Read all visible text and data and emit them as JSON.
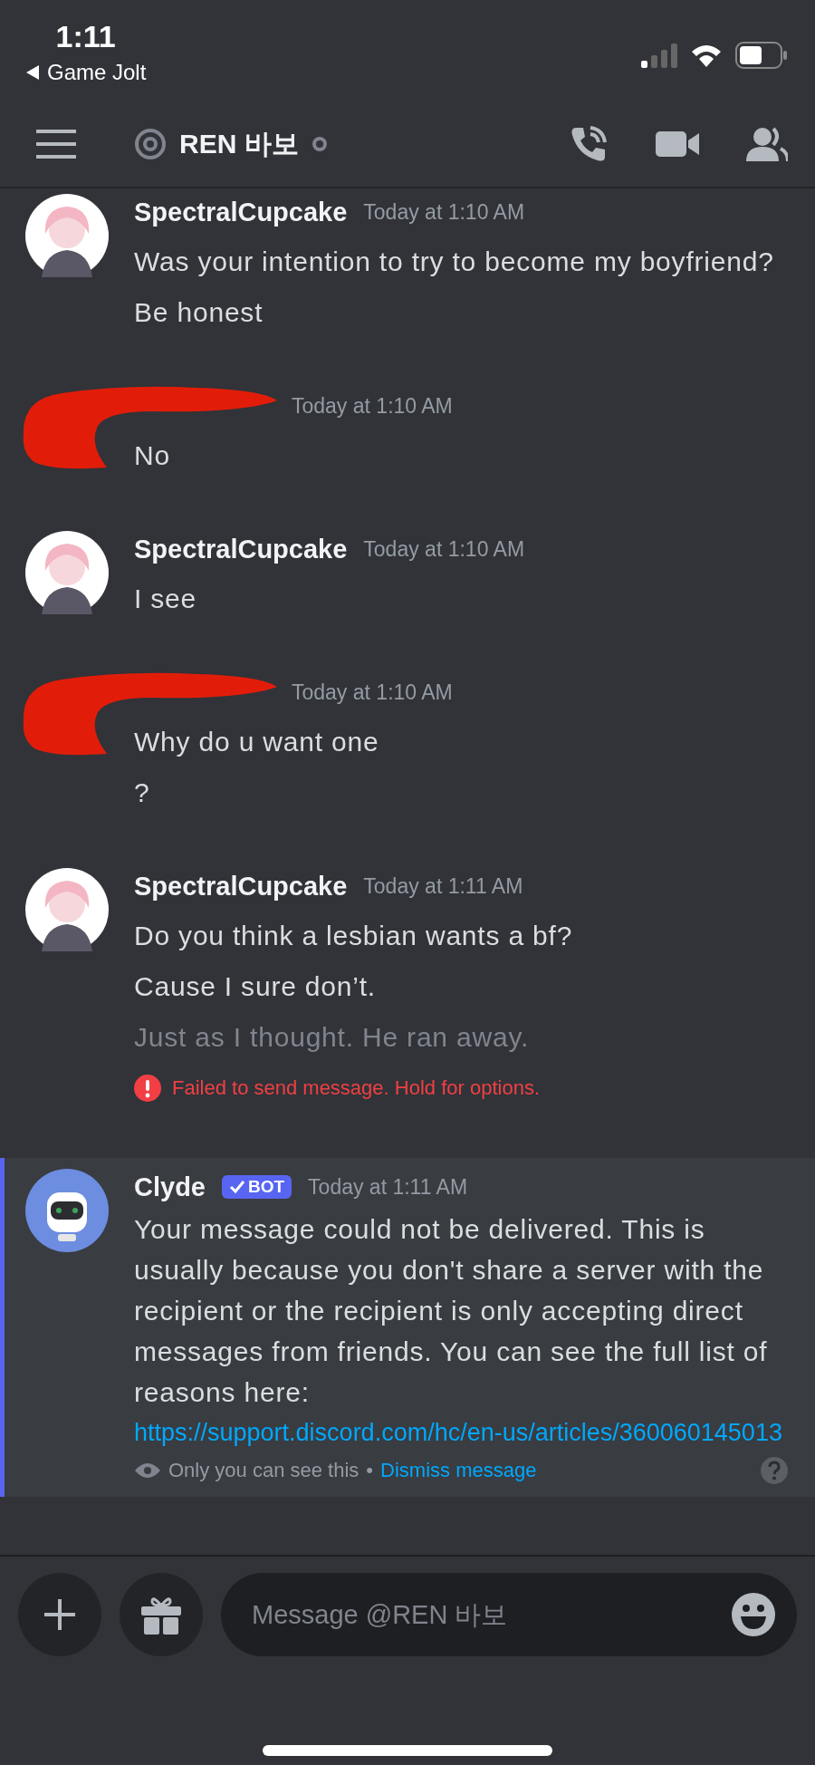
{
  "status_bar": {
    "time": "1:11",
    "back_label": "Game Jolt"
  },
  "header": {
    "channel_name": "REN 바보"
  },
  "messages": [
    {
      "author": "SpectralCupcake",
      "redacted": false,
      "time": "Today at 1:10 AM",
      "lines": [
        {
          "text": "Was your intention to try to become my boyfriend?",
          "failed": false
        },
        {
          "text": "Be honest",
          "failed": false
        }
      ]
    },
    {
      "redacted": true,
      "time": "Today at 1:10 AM",
      "lines": [
        {
          "text": "No",
          "failed": false
        }
      ]
    },
    {
      "author": "SpectralCupcake",
      "redacted": false,
      "time": "Today at 1:10 AM",
      "lines": [
        {
          "text": "I see",
          "failed": false
        }
      ]
    },
    {
      "redacted": true,
      "time": "Today at 1:10 AM",
      "lines": [
        {
          "text": "Why do u want one",
          "failed": false
        },
        {
          "text": "?",
          "failed": false
        }
      ]
    },
    {
      "author": "SpectralCupcake",
      "redacted": false,
      "time": "Today at 1:11 AM",
      "lines": [
        {
          "text": "Do you think a lesbian wants a bf?",
          "failed": false
        },
        {
          "text": "Cause I sure don’t.",
          "failed": false
        },
        {
          "text": "Just as I thought. He ran away.",
          "failed": true
        }
      ],
      "error": "Failed to send message. Hold for options."
    }
  ],
  "system_message": {
    "author": "Clyde",
    "badge": "BOT",
    "time": "Today at 1:11 AM",
    "text": "Your message could not be delivered. This is usually because you don't share a server with the recipient or the recipient is only accepting direct messages from friends. You can see the full list of reasons here:",
    "link": "https://support.discord.com/hc/en-us/articles/360060145013",
    "note": "Only you can see this",
    "separator": "•",
    "dismiss": "Dismiss message"
  },
  "composer": {
    "placeholder": "Message @REN 바보"
  }
}
